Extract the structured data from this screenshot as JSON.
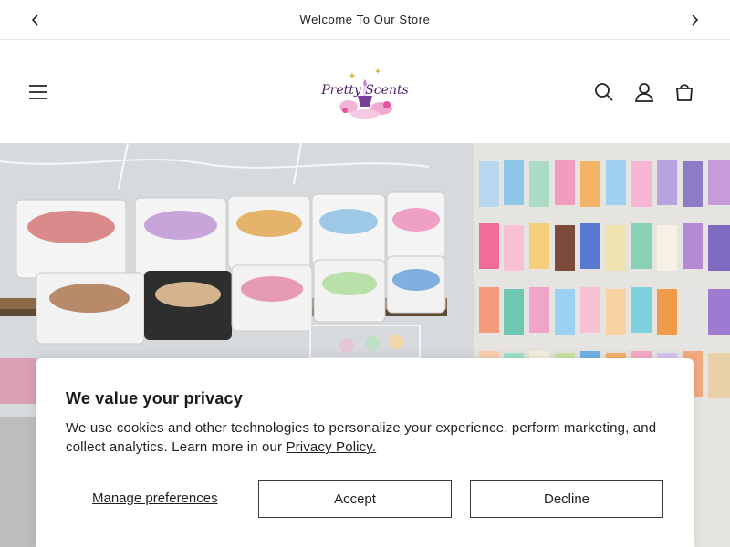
{
  "announcement": {
    "text": "Welcome To Our Store",
    "prev_icon": "chevron-left-icon",
    "next_icon": "chevron-right-icon"
  },
  "header": {
    "logo_text": "Pretty Scents",
    "menu_icon": "hamburger-icon",
    "search_icon": "search-icon",
    "account_icon": "user-icon",
    "cart_icon": "cart-icon"
  },
  "hero": {
    "image_description_icon": "store-shelves-photo"
  },
  "cookie_banner": {
    "title": "We value your privacy",
    "body": "We use cookies and other technologies to personalize your experience, perform marketing, and collect analytics. Learn more in our ",
    "policy_link": "Privacy Policy.",
    "manage_label": "Manage preferences",
    "accept_label": "Accept",
    "decline_label": "Decline"
  },
  "colors": {
    "logo_purple": "#5a2a7a",
    "logo_pink": "#e58ac0",
    "border": "#3a3a3a"
  }
}
